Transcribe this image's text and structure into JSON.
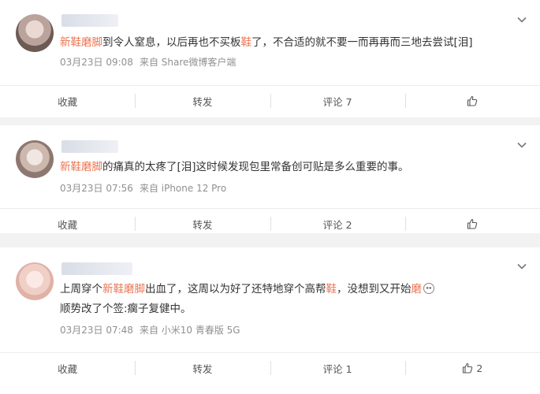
{
  "posts": [
    {
      "text_hl": "新鞋磨脚",
      "text_a": "到令人窒息，以后再也不买板",
      "text_hl2": "鞋",
      "text_b": "了，不合适的就不要一而再再而三地去尝试[泪]",
      "date": "03月23日 09:08",
      "source": "来自 Share微博客户端",
      "actions": {
        "favorite": "收藏",
        "repost": "转发",
        "comment": "评论 7",
        "like_count": ""
      }
    },
    {
      "text_hl": "新鞋磨脚",
      "text_a": "的痛真的太疼了[泪]这时候发现包里常备创可贴是多么重要的事。",
      "date": "03月23日 07:56",
      "source": "来自 iPhone 12 Pro",
      "actions": {
        "favorite": "收藏",
        "repost": "转发",
        "comment": "评论 2",
        "like_count": ""
      }
    },
    {
      "text_pre": "上周穿个",
      "text_hl": "新鞋磨脚",
      "text_a": "出血了，这周以为好了还特地穿个高帮",
      "text_hl2": "鞋",
      "text_b": "，没想到又开始",
      "text_hl3": "磨",
      "text_line2": "顺势改了个签:瘸子复健中。",
      "date": "03月23日 07:48",
      "source": "来自 小米10 青春版 5G",
      "actions": {
        "favorite": "收藏",
        "repost": "转发",
        "comment": "评论 1",
        "like_count": "2"
      }
    }
  ],
  "icons": {
    "more": "chevron-down-icon",
    "like": "thumbs-up-icon",
    "emoji": "dizzy-emoji-icon"
  },
  "colors": {
    "highlight": "#eb7350",
    "meta": "#909090",
    "background": "#f2f2f2"
  }
}
